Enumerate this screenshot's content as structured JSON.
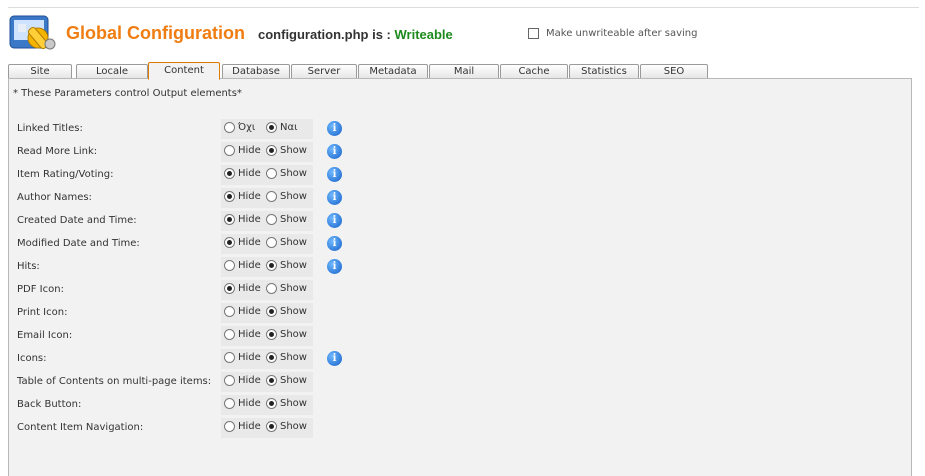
{
  "header": {
    "title": "Global Configuration",
    "config_prefix": "configuration.php is : ",
    "config_status": "Writeable",
    "unwriteable_label": "Make unwriteable after saving"
  },
  "tabs": [
    {
      "label": "Site",
      "active": false
    },
    {
      "label": "Locale",
      "active": false
    },
    {
      "label": "Content",
      "active": true
    },
    {
      "label": "Database",
      "active": false
    },
    {
      "label": "Server",
      "active": false
    },
    {
      "label": "Metadata",
      "active": false
    },
    {
      "label": "Mail",
      "active": false
    },
    {
      "label": "Cache",
      "active": false
    },
    {
      "label": "Statistics",
      "active": false
    },
    {
      "label": "SEO",
      "active": false
    }
  ],
  "panel": {
    "note": "* These Parameters control Output elements*",
    "rows": [
      {
        "label": "Linked Titles:",
        "opt1": "Όχι",
        "opt2": "Ναι",
        "selected": 2,
        "info": true
      },
      {
        "label": "Read More Link:",
        "opt1": "Hide",
        "opt2": "Show",
        "selected": 2,
        "info": true
      },
      {
        "label": "Item Rating/Voting:",
        "opt1": "Hide",
        "opt2": "Show",
        "selected": 1,
        "info": true
      },
      {
        "label": "Author Names:",
        "opt1": "Hide",
        "opt2": "Show",
        "selected": 1,
        "info": true
      },
      {
        "label": "Created Date and Time:",
        "opt1": "Hide",
        "opt2": "Show",
        "selected": 1,
        "info": true
      },
      {
        "label": "Modified Date and Time:",
        "opt1": "Hide",
        "opt2": "Show",
        "selected": 1,
        "info": true
      },
      {
        "label": "Hits:",
        "opt1": "Hide",
        "opt2": "Show",
        "selected": 2,
        "info": true
      },
      {
        "label": "PDF Icon:",
        "opt1": "Hide",
        "opt2": "Show",
        "selected": 1,
        "info": false
      },
      {
        "label": "Print Icon:",
        "opt1": "Hide",
        "opt2": "Show",
        "selected": 2,
        "info": false
      },
      {
        "label": "Email Icon:",
        "opt1": "Hide",
        "opt2": "Show",
        "selected": 2,
        "info": false
      },
      {
        "label": "Icons:",
        "opt1": "Hide",
        "opt2": "Show",
        "selected": 2,
        "info": true
      },
      {
        "label": "Table of Contents on multi-page items:",
        "opt1": "Hide",
        "opt2": "Show",
        "selected": 2,
        "info": false
      },
      {
        "label": "Back Button:",
        "opt1": "Hide",
        "opt2": "Show",
        "selected": 2,
        "info": false
      },
      {
        "label": "Content Item Navigation:",
        "opt1": "Hide",
        "opt2": "Show",
        "selected": 2,
        "info": false
      }
    ]
  },
  "info_icon_glyph": "i",
  "colors": {
    "title": "#f07d12",
    "writeable": "#1e8a1e",
    "active_tab_border": "#e07a00",
    "info": "#1560c8"
  }
}
